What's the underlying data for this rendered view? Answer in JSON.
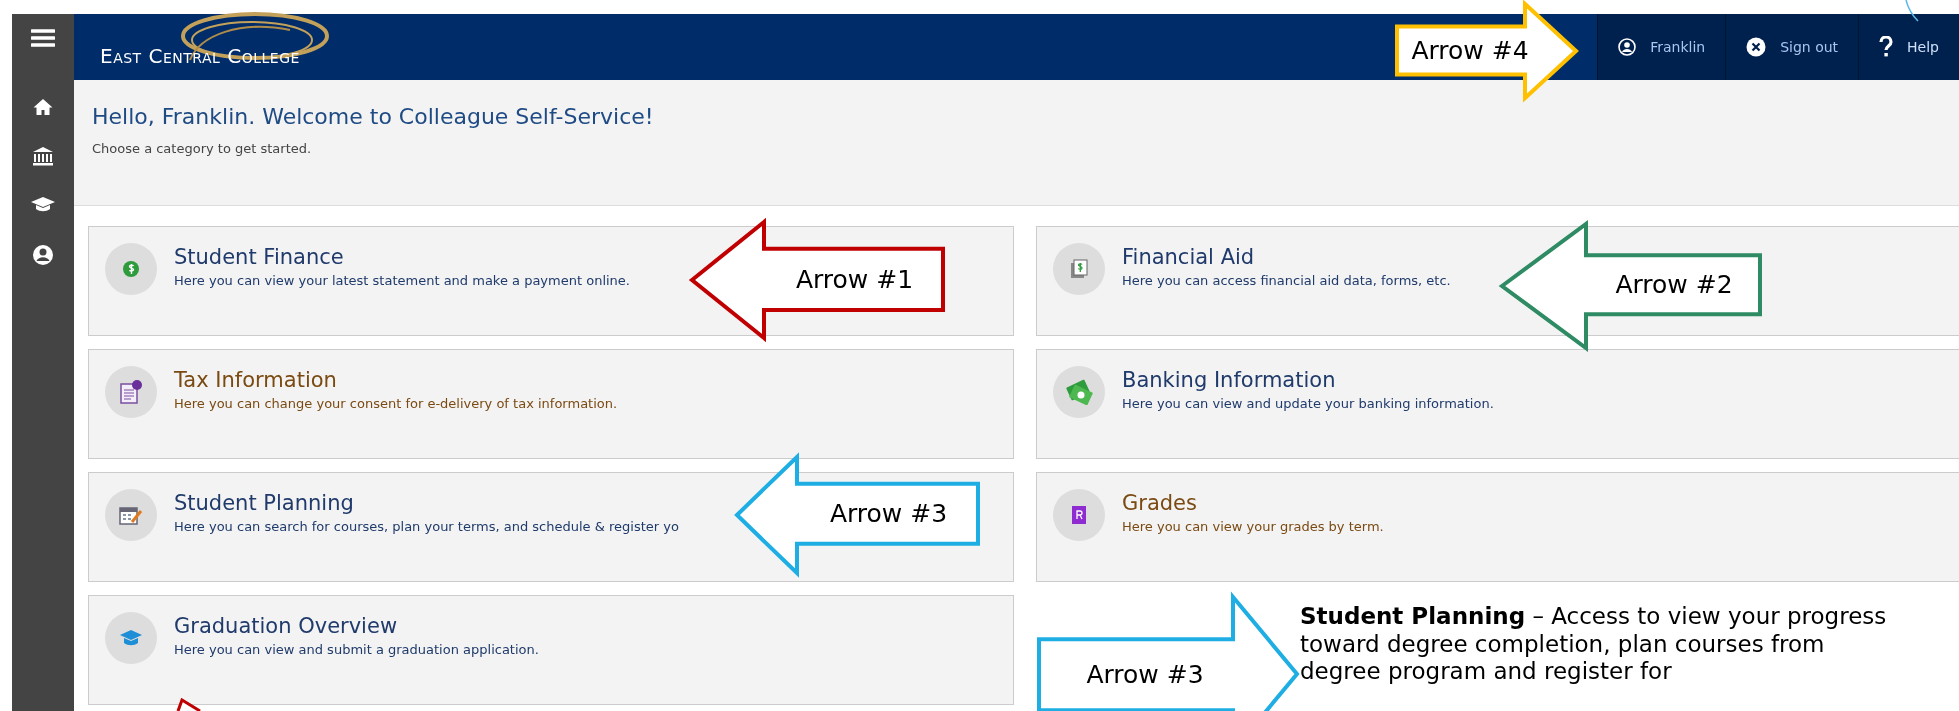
{
  "header": {
    "logo": "East Central College",
    "user": "Franklin",
    "sign_out": "Sign out",
    "help": "Help"
  },
  "welcome": {
    "title": "Hello, Franklin. Welcome to Colleague Self-Service!",
    "subtitle": "Choose a category to get started."
  },
  "categories": [
    {
      "kind": "coin",
      "title": "Student Finance",
      "description": "Here you can view your latest statement and make a payment online.",
      "visited": false
    },
    {
      "kind": "aid",
      "title": "Financial Aid",
      "description": "Here you can access financial aid data, forms, etc.",
      "visited": false
    },
    {
      "kind": "tax",
      "title": "Tax Information",
      "description": "Here you can change your consent for e-delivery of tax information.",
      "visited": true
    },
    {
      "kind": "bank",
      "title": "Banking Information",
      "description": "Here you can view and update your banking information.",
      "visited": false
    },
    {
      "kind": "plan",
      "title": "Student Planning",
      "description": "Here you can search for courses, plan your terms, and schedule & register yo",
      "visited": false
    },
    {
      "kind": "grades",
      "title": "Grades",
      "description": "Here you can view your grades by term.",
      "visited": true
    },
    {
      "kind": "grad",
      "title": "Graduation Overview",
      "description": "Here you can view and submit a graduation application.",
      "visited": false
    }
  ],
  "annotations": [
    {
      "kind": "left",
      "label": "Arrow #1",
      "color": "#c00000"
    },
    {
      "kind": "left",
      "label": "Arrow #2",
      "color": "#2e8b64"
    },
    {
      "kind": "left",
      "label": "Arrow #3",
      "color": "#1eaee3"
    },
    {
      "kind": "right",
      "label": "Arrow #4",
      "color": "#ffc000"
    },
    {
      "kind": "right",
      "label": "Arrow #3",
      "color": "#1eaee3"
    }
  ],
  "note": "**Student Planning** – Access to view your progress toward degree completion, plan courses from degree program and register for"
}
